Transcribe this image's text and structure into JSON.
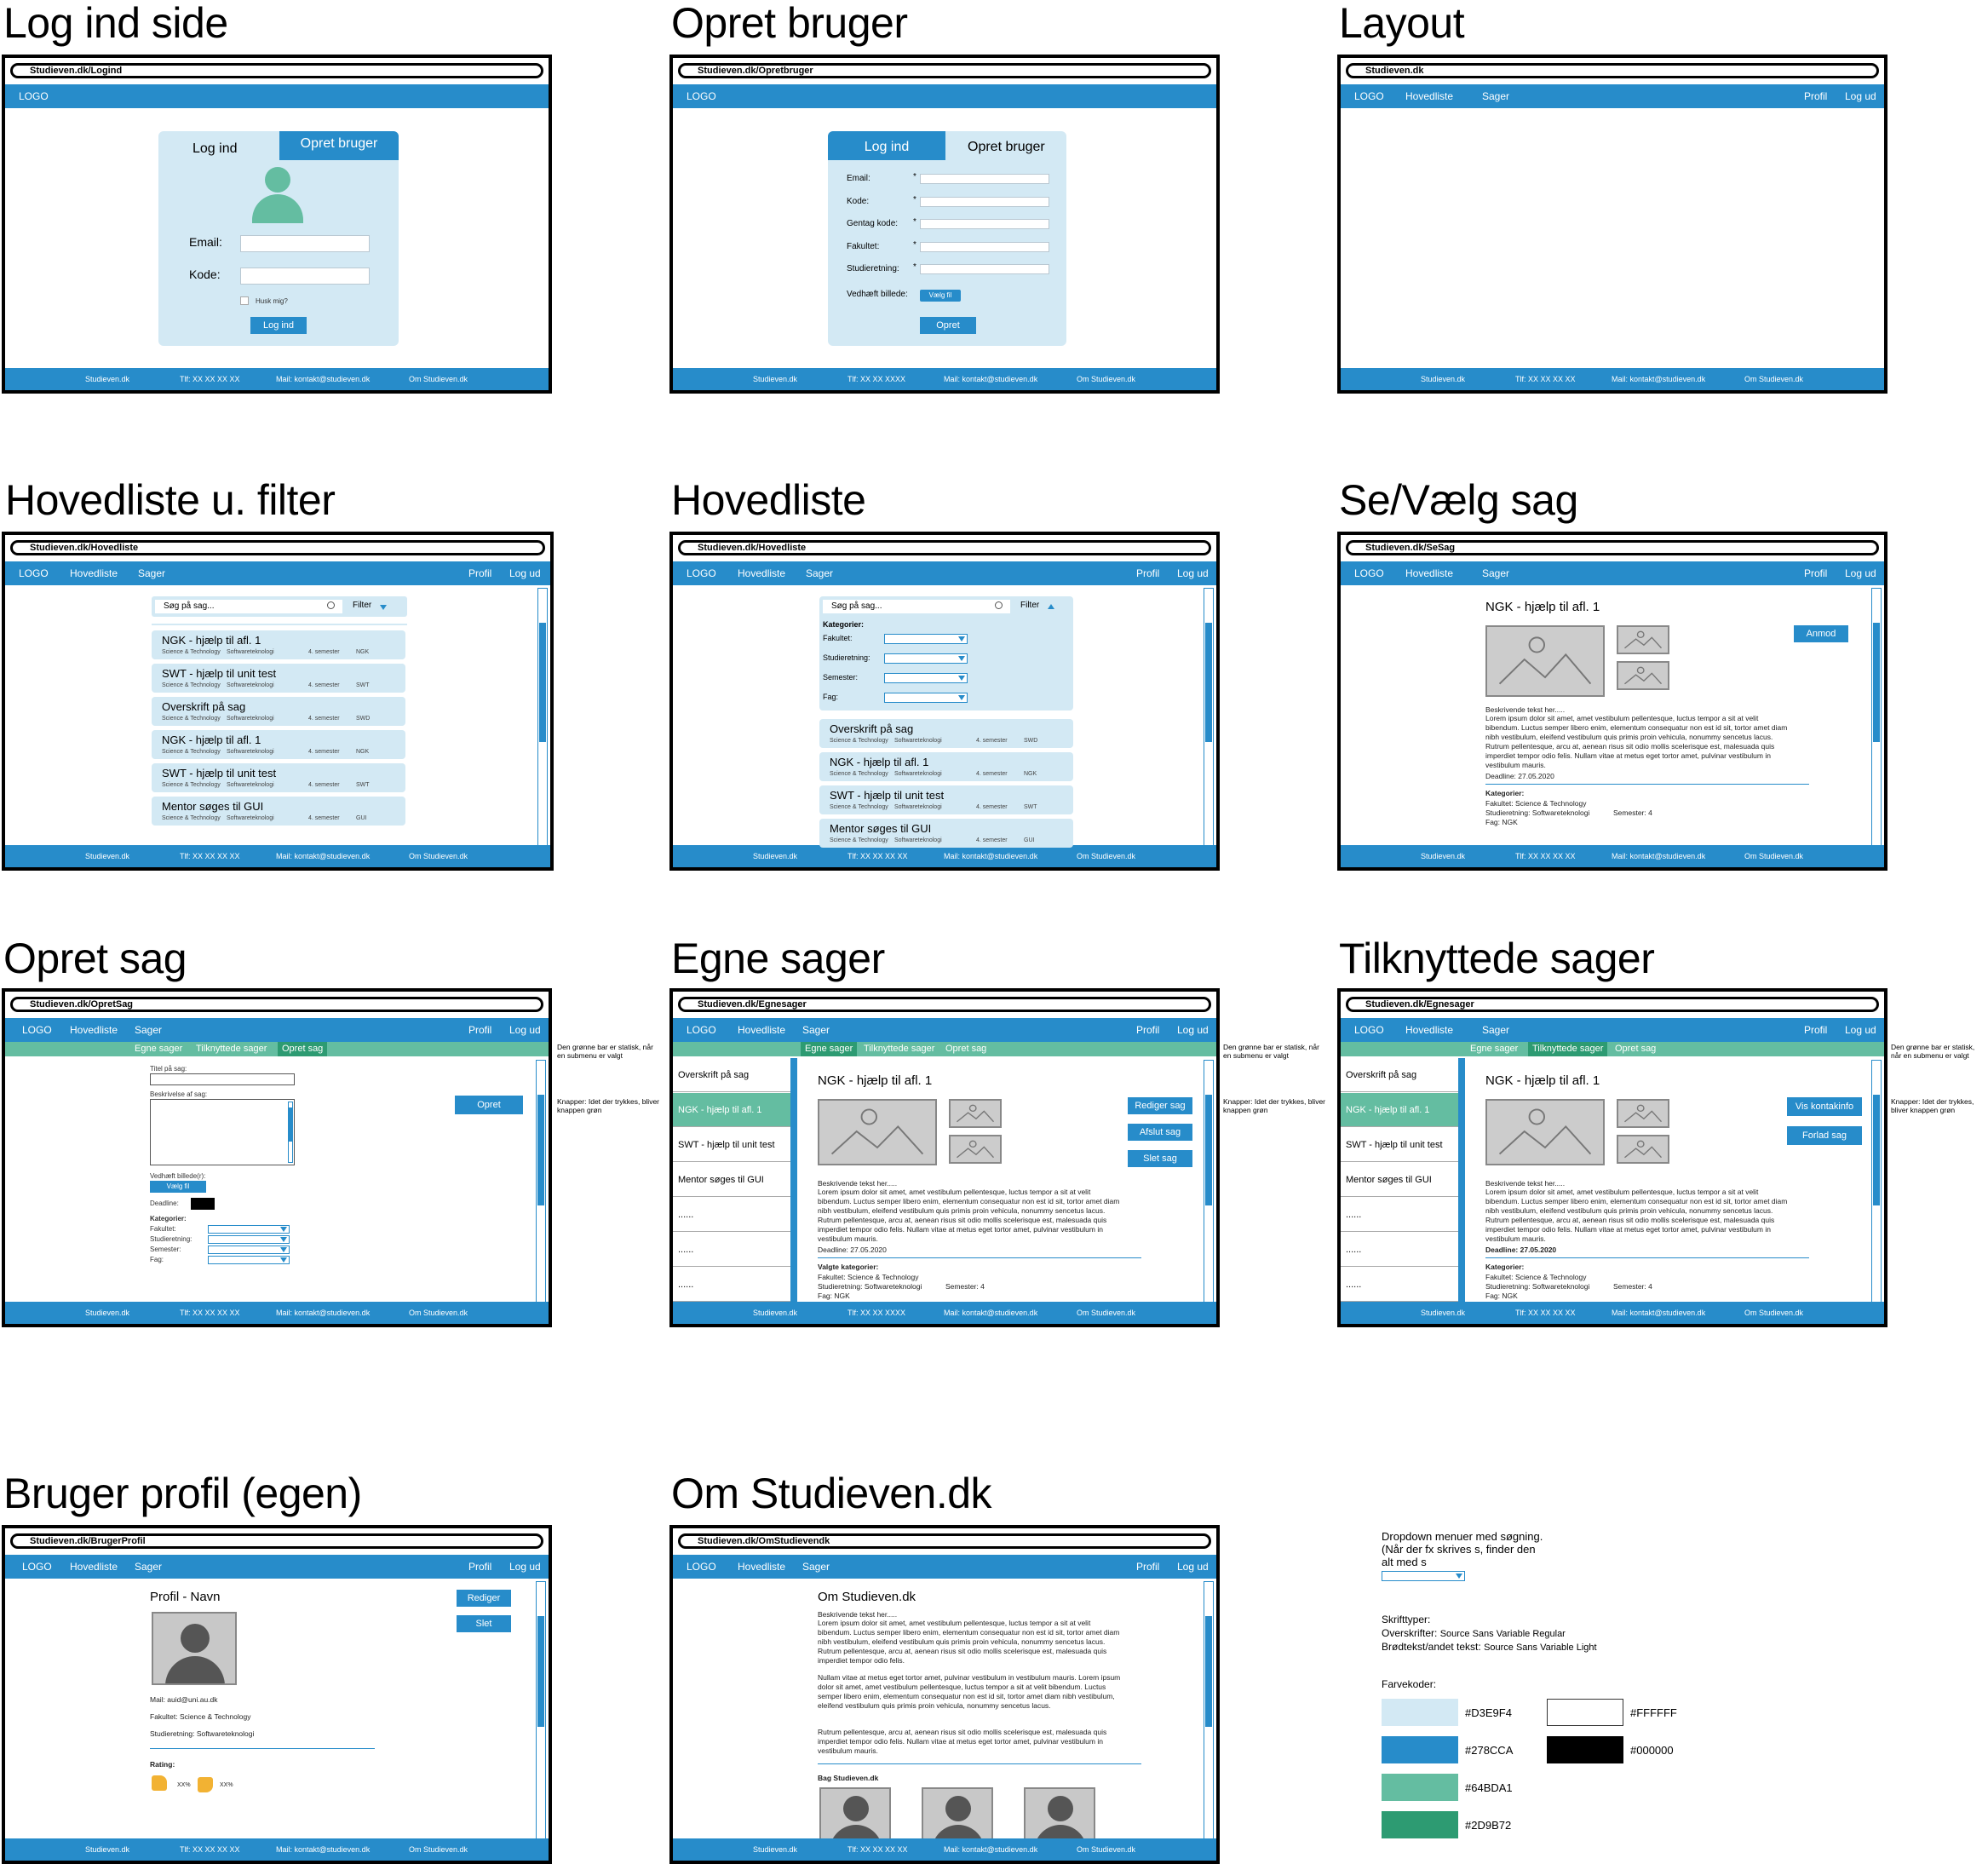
{
  "titles": {
    "login": "Log ind side",
    "opret_bruger": "Opret bruger",
    "layout": "Layout",
    "hovedliste_u_filter": "Hovedliste u. filter",
    "hovedliste": "Hovedliste",
    "se_vaelg_sag": "Se/Vælg sag",
    "opret_sag": "Opret sag",
    "egne_sager": "Egne sager",
    "tilknyttede_sager": "Tilknyttede sager",
    "bruger_profil": "Bruger profil (egen)",
    "om": "Om Studieven.dk"
  },
  "urls": {
    "login": "Studieven.dk/Logind",
    "opret_bruger": "Studieven.dk/Opretbruger",
    "layout": "Studieven.dk",
    "hovedliste_u_filter": "Studieven.dk/Hovedliste",
    "hovedliste": "Studieven.dk/Hovedliste",
    "se_vaelg_sag": "Studieven.dk/SeSag",
    "opret_sag": "Studieven.dk/OpretSag",
    "egne_sager": "Studieven.dk/Egnesager",
    "tilknyttede_sager": "Studieven.dk/Egnesager",
    "bruger_profil": "Studieven.dk/BrugerProfil",
    "om": "Studieven.dk/OmStudievendk"
  },
  "nav": {
    "logo": "LOGO",
    "hovedliste": "Hovedliste",
    "sager": "Sager",
    "profil": "Profil",
    "log_ud": "Log ud"
  },
  "footer": {
    "site": "Studieven.dk",
    "tlf": "Tlf: XX XX XX XX",
    "tlf_alt": "Tlf: XX XX XXXX",
    "mail": "Mail: kontakt@studieven.dk",
    "om": "Om Studieven.dk"
  },
  "login": {
    "tab_login": "Log ind",
    "tab_create": "Opret bruger",
    "email_label": "Email:",
    "kode_label": "Kode:",
    "remember": "Husk mig?",
    "submit": "Log ind"
  },
  "create_user": {
    "tab_login": "Log ind",
    "tab_create": "Opret bruger",
    "fields": [
      "Email:",
      "Kode:",
      "Gentag kode:",
      "Fakultet:",
      "Studieretning:"
    ],
    "required_mark": "*",
    "attach_label": "Vedhæft billede:",
    "choose_file": "Vælg fil",
    "submit": "Opret"
  },
  "search": {
    "placeholder": "Søg på sag...",
    "filter": "Filter"
  },
  "filter": {
    "heading": "Kategorier:",
    "fields": [
      "Fakultet:",
      "Studieretning:",
      "Semester:",
      "Fag:"
    ]
  },
  "list_items": [
    {
      "title": "NGK - hjælp til afl. 1",
      "fak": "Science & Technology",
      "ret": "Softwareteknologi",
      "sem": "4. semester",
      "fag": "NGK"
    },
    {
      "title": "SWT - hjælp til unit test",
      "fak": "Science & Technology",
      "ret": "Softwareteknologi",
      "sem": "4. semester",
      "fag": "SWT"
    },
    {
      "title": "Overskrift på sag",
      "fak": "Science & Technology",
      "ret": "Softwareteknologi",
      "sem": "4. semester",
      "fag": "SWD"
    },
    {
      "title": "NGK - hjælp til afl. 1",
      "fak": "Science & Technology",
      "ret": "Softwareteknologi",
      "sem": "4. semester",
      "fag": "NGK"
    },
    {
      "title": "SWT - hjælp til unit test",
      "fak": "Science & Technology",
      "ret": "Softwareteknologi",
      "sem": "4. semester",
      "fag": "SWT"
    },
    {
      "title": "Mentor søges til GUI",
      "fak": "Science & Technology",
      "ret": "Softwareteknologi",
      "sem": "4. semester",
      "fag": "GUI"
    }
  ],
  "list_items_filtered": [
    {
      "title": "Overskrift på sag",
      "fak": "Science & Technology",
      "ret": "Softwareteknologi",
      "sem": "4. semester",
      "fag": "SWD"
    },
    {
      "title": "NGK - hjælp til afl. 1",
      "fak": "Science & Technology",
      "ret": "Softwareteknologi",
      "sem": "4. semester",
      "fag": "NGK"
    },
    {
      "title": "SWT - hjælp til unit test",
      "fak": "Science & Technology",
      "ret": "Softwareteknologi",
      "sem": "4. semester",
      "fag": "SWT"
    },
    {
      "title": "Mentor søges til GUI",
      "fak": "Science & Technology",
      "ret": "Softwareteknologi",
      "sem": "4. semester",
      "fag": "GUI"
    }
  ],
  "case": {
    "title": "NGK - hjælp til afl. 1",
    "desc_heading": "Beskrivende tekst her.....",
    "desc": "Lorem ipsum dolor sit amet, amet vestibulum pellentesque, luctus tempor a sit at velit bibendum. Luctus semper libero enim, elementum consequatur non est id sit, tortor amet diam nibh vestibulum, eleifend vestibulum quis primis proin vehicula, nonummy sencetus lacus. Rutrum pellentesque, arcu at, aenean risus sit odio mollis scelerisque est, malesuada quis imperdiet tempor odio felis. Nullam vitae at metus eget tortor amet, pulvinar vestibulum in vestibulum mauris.",
    "deadline": "Deadline: 27.05.2020",
    "kategorier": "Kategorier:",
    "valgte_kategorier": "Valgte kategorier:",
    "fakultet": "Fakultet: Science & Technology",
    "studieretning": "Studieretning: Softwareteknologi",
    "semester": "Semester: 4",
    "fag": "Fag: NGK",
    "anmod": "Anmod"
  },
  "opret_sag": {
    "titel": "Titel på sag:",
    "beskrivelse": "Beskrivelse af sag:",
    "vedhaeft": "Vedhæft billede(r):",
    "choose_file": "Vælg fil",
    "deadline": "Deadline:",
    "kategorier": "Kategorier:",
    "fields": [
      "Fakultet:",
      "Studieretning:",
      "Semester:",
      "Fag:"
    ],
    "submit": "Opret"
  },
  "submenu": {
    "egne": "Egne sager",
    "tilknyttede": "Tilknyttede sager",
    "opret": "Opret sag"
  },
  "side_list": [
    "Overskrift på sag",
    "NGK - hjælp til afl. 1",
    "SWT - hjælp til unit test",
    "Mentor søges til GUI",
    "......",
    "......",
    "......"
  ],
  "egne_buttons": [
    "Rediger sag",
    "Afslut sag",
    "Slet sag"
  ],
  "tilknyttede_buttons": [
    "Vis kontakinfo",
    "Forlad sag"
  ],
  "notes": {
    "green_bar": "Den grønne bar er statisk, når en submenu er valgt",
    "buttons": "Knapper: Idet der trykkes, bliver knappen grøn"
  },
  "profile": {
    "name": "Profil - Navn",
    "edit": "Rediger",
    "delete": "Slet",
    "mail": "Mail: auid@uni.au.dk",
    "fakultet": "Fakultet: Science & Technology",
    "studieretning": "Studieretning: Softwareteknologi",
    "rating": "Rating:",
    "up": "XX%",
    "down": "XX%"
  },
  "about": {
    "title": "Om Studieven.dk",
    "heading": "Beskrivende tekst her.....",
    "p1": "Lorem ipsum dolor sit amet, amet vestibulum pellentesque, luctus tempor a sit at velit bibendum. Luctus semper libero enim, elementum consequatur non est id sit, tortor amet diam nibh vestibulum, eleifend vestibulum quis primis proin vehicula, nonummy sencetus lacus. Rutrum pellentesque, arcu at, aenean risus sit odio mollis scelerisque est, malesuada quis imperdiet tempor odio felis.",
    "p2": "Nullam vitae at metus eget tortor amet, pulvinar vestibulum in vestibulum mauris. Lorem ipsum dolor sit amet, amet vestibulum pellentesque, luctus tempor a sit at velit bibendum. Luctus semper libero enim, elementum consequatur non est id sit, tortor amet diam nibh vestibulum, eleifend vestibulum quis primis proin vehicula, nonummy sencetus lacus.",
    "p3": "Rutrum pellentesque, arcu at, aenean risus sit odio mollis scelerisque est, malesuada quis imperdiet tempor odio felis. Nullam vitae at metus eget tortor amet, pulvinar vestibulum in vestibulum mauris.",
    "bag": "Bag Studieven.dk"
  },
  "legend": {
    "dropdown_note": "Dropdown menuer med søgning. (Når der fx skrives s, finder den alt med s",
    "skrift": "Skrifttyper:",
    "overskrifter_label": "Overskrifter:",
    "overskrifter_font": "Source Sans Variable Regular",
    "brod_label": "Brødtekst/andet tekst:",
    "brod_font": "Source Sans Variable Light",
    "farvekoder": "Farvekoder:",
    "colors": [
      {
        "hex": "#D3E9F4"
      },
      {
        "hex": "#278CCA"
      },
      {
        "hex": "#64BDA1"
      },
      {
        "hex": "#2D9B72"
      },
      {
        "hex": "#FFFFFF"
      },
      {
        "hex": "#000000"
      }
    ]
  }
}
